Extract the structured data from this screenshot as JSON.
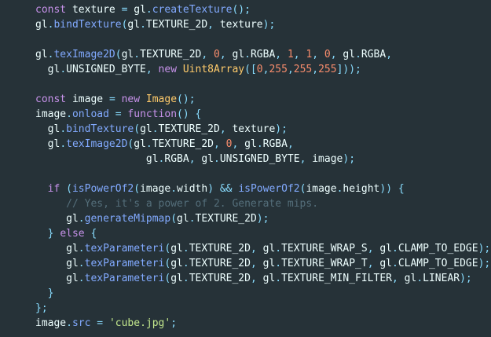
{
  "theme": {
    "background": "#263238",
    "text": "#eeffff",
    "keyword": "#c792ea",
    "function": "#82aaff",
    "number": "#f78c6c",
    "class": "#ffcb6b",
    "string": "#c3e88d",
    "punctuation": "#89ddff",
    "comment": "#546e7a"
  },
  "code_lines": [
    [
      [
        "kw",
        "const"
      ],
      [
        "id",
        " texture "
      ],
      [
        "punc",
        "="
      ],
      [
        "id",
        " gl"
      ],
      [
        "punc",
        "."
      ],
      [
        "fn",
        "createTexture"
      ],
      [
        "punc",
        "();"
      ]
    ],
    [
      [
        "id",
        "gl"
      ],
      [
        "punc",
        "."
      ],
      [
        "fn",
        "bindTexture"
      ],
      [
        "punc",
        "("
      ],
      [
        "id",
        "gl"
      ],
      [
        "punc",
        "."
      ],
      [
        "id",
        "TEXTURE_2D"
      ],
      [
        "punc",
        ","
      ],
      [
        "id",
        " texture"
      ],
      [
        "punc",
        ");"
      ]
    ],
    [],
    [
      [
        "id",
        "gl"
      ],
      [
        "punc",
        "."
      ],
      [
        "fn",
        "texImage2D"
      ],
      [
        "punc",
        "("
      ],
      [
        "id",
        "gl"
      ],
      [
        "punc",
        "."
      ],
      [
        "id",
        "TEXTURE_2D"
      ],
      [
        "punc",
        ","
      ],
      [
        "id",
        " "
      ],
      [
        "num",
        "0"
      ],
      [
        "punc",
        ","
      ],
      [
        "id",
        " gl"
      ],
      [
        "punc",
        "."
      ],
      [
        "id",
        "RGBA"
      ],
      [
        "punc",
        ","
      ],
      [
        "id",
        " "
      ],
      [
        "num",
        "1"
      ],
      [
        "punc",
        ","
      ],
      [
        "id",
        " "
      ],
      [
        "num",
        "1"
      ],
      [
        "punc",
        ","
      ],
      [
        "id",
        " "
      ],
      [
        "num",
        "0"
      ],
      [
        "punc",
        ","
      ],
      [
        "id",
        " gl"
      ],
      [
        "punc",
        "."
      ],
      [
        "id",
        "RGBA"
      ],
      [
        "punc",
        ","
      ]
    ],
    [
      [
        "id",
        "  gl"
      ],
      [
        "punc",
        "."
      ],
      [
        "id",
        "UNSIGNED_BYTE"
      ],
      [
        "punc",
        ","
      ],
      [
        "id",
        " "
      ],
      [
        "kw",
        "new"
      ],
      [
        "id",
        " "
      ],
      [
        "cls",
        "Uint8Array"
      ],
      [
        "punc",
        "(["
      ],
      [
        "num",
        "0"
      ],
      [
        "punc",
        ","
      ],
      [
        "num",
        "255"
      ],
      [
        "punc",
        ","
      ],
      [
        "num",
        "255"
      ],
      [
        "punc",
        ","
      ],
      [
        "num",
        "255"
      ],
      [
        "punc",
        "]));"
      ]
    ],
    [],
    [
      [
        "kw",
        "const"
      ],
      [
        "id",
        " image "
      ],
      [
        "punc",
        "="
      ],
      [
        "id",
        " "
      ],
      [
        "kw",
        "new"
      ],
      [
        "id",
        " "
      ],
      [
        "cls",
        "Image"
      ],
      [
        "punc",
        "();"
      ]
    ],
    [
      [
        "id",
        "image"
      ],
      [
        "punc",
        "."
      ],
      [
        "fn",
        "onload"
      ],
      [
        "id",
        " "
      ],
      [
        "punc",
        "="
      ],
      [
        "id",
        " "
      ],
      [
        "kw",
        "function"
      ],
      [
        "punc",
        "()"
      ],
      [
        "id",
        " "
      ],
      [
        "punc",
        "{"
      ]
    ],
    [
      [
        "id",
        "  gl"
      ],
      [
        "punc",
        "."
      ],
      [
        "fn",
        "bindTexture"
      ],
      [
        "punc",
        "("
      ],
      [
        "id",
        "gl"
      ],
      [
        "punc",
        "."
      ],
      [
        "id",
        "TEXTURE_2D"
      ],
      [
        "punc",
        ","
      ],
      [
        "id",
        " texture"
      ],
      [
        "punc",
        ");"
      ]
    ],
    [
      [
        "id",
        "  gl"
      ],
      [
        "punc",
        "."
      ],
      [
        "fn",
        "texImage2D"
      ],
      [
        "punc",
        "("
      ],
      [
        "id",
        "gl"
      ],
      [
        "punc",
        "."
      ],
      [
        "id",
        "TEXTURE_2D"
      ],
      [
        "punc",
        ","
      ],
      [
        "id",
        " "
      ],
      [
        "num",
        "0"
      ],
      [
        "punc",
        ","
      ],
      [
        "id",
        " gl"
      ],
      [
        "punc",
        "."
      ],
      [
        "id",
        "RGBA"
      ],
      [
        "punc",
        ","
      ]
    ],
    [
      [
        "id",
        "                  gl"
      ],
      [
        "punc",
        "."
      ],
      [
        "id",
        "RGBA"
      ],
      [
        "punc",
        ","
      ],
      [
        "id",
        " gl"
      ],
      [
        "punc",
        "."
      ],
      [
        "id",
        "UNSIGNED_BYTE"
      ],
      [
        "punc",
        ","
      ],
      [
        "id",
        " image"
      ],
      [
        "punc",
        ");"
      ]
    ],
    [],
    [
      [
        "id",
        "  "
      ],
      [
        "kw",
        "if"
      ],
      [
        "id",
        " "
      ],
      [
        "punc",
        "("
      ],
      [
        "fn",
        "isPowerOf2"
      ],
      [
        "punc",
        "("
      ],
      [
        "id",
        "image"
      ],
      [
        "punc",
        "."
      ],
      [
        "id",
        "width"
      ],
      [
        "punc",
        ")"
      ],
      [
        "id",
        " "
      ],
      [
        "punc",
        "&&"
      ],
      [
        "id",
        " "
      ],
      [
        "fn",
        "isPowerOf2"
      ],
      [
        "punc",
        "("
      ],
      [
        "id",
        "image"
      ],
      [
        "punc",
        "."
      ],
      [
        "id",
        "height"
      ],
      [
        "punc",
        "))"
      ],
      [
        "id",
        " "
      ],
      [
        "punc",
        "{"
      ]
    ],
    [
      [
        "cm",
        "     // Yes, it's a power of 2. Generate mips."
      ]
    ],
    [
      [
        "id",
        "     gl"
      ],
      [
        "punc",
        "."
      ],
      [
        "fn",
        "generateMipmap"
      ],
      [
        "punc",
        "("
      ],
      [
        "id",
        "gl"
      ],
      [
        "punc",
        "."
      ],
      [
        "id",
        "TEXTURE_2D"
      ],
      [
        "punc",
        ");"
      ]
    ],
    [
      [
        "id",
        "  "
      ],
      [
        "punc",
        "}"
      ],
      [
        "id",
        " "
      ],
      [
        "kw",
        "else"
      ],
      [
        "id",
        " "
      ],
      [
        "punc",
        "{"
      ]
    ],
    [
      [
        "id",
        "     gl"
      ],
      [
        "punc",
        "."
      ],
      [
        "fn",
        "texParameteri"
      ],
      [
        "punc",
        "("
      ],
      [
        "id",
        "gl"
      ],
      [
        "punc",
        "."
      ],
      [
        "id",
        "TEXTURE_2D"
      ],
      [
        "punc",
        ","
      ],
      [
        "id",
        " gl"
      ],
      [
        "punc",
        "."
      ],
      [
        "id",
        "TEXTURE_WRAP_S"
      ],
      [
        "punc",
        ","
      ],
      [
        "id",
        " gl"
      ],
      [
        "punc",
        "."
      ],
      [
        "id",
        "CLAMP_TO_EDGE"
      ],
      [
        "punc",
        ");"
      ]
    ],
    [
      [
        "id",
        "     gl"
      ],
      [
        "punc",
        "."
      ],
      [
        "fn",
        "texParameteri"
      ],
      [
        "punc",
        "("
      ],
      [
        "id",
        "gl"
      ],
      [
        "punc",
        "."
      ],
      [
        "id",
        "TEXTURE_2D"
      ],
      [
        "punc",
        ","
      ],
      [
        "id",
        " gl"
      ],
      [
        "punc",
        "."
      ],
      [
        "id",
        "TEXTURE_WRAP_T"
      ],
      [
        "punc",
        ","
      ],
      [
        "id",
        " gl"
      ],
      [
        "punc",
        "."
      ],
      [
        "id",
        "CLAMP_TO_EDGE"
      ],
      [
        "punc",
        ");"
      ]
    ],
    [
      [
        "id",
        "     gl"
      ],
      [
        "punc",
        "."
      ],
      [
        "fn",
        "texParameteri"
      ],
      [
        "punc",
        "("
      ],
      [
        "id",
        "gl"
      ],
      [
        "punc",
        "."
      ],
      [
        "id",
        "TEXTURE_2D"
      ],
      [
        "punc",
        ","
      ],
      [
        "id",
        " gl"
      ],
      [
        "punc",
        "."
      ],
      [
        "id",
        "TEXTURE_MIN_FILTER"
      ],
      [
        "punc",
        ","
      ],
      [
        "id",
        " gl"
      ],
      [
        "punc",
        "."
      ],
      [
        "id",
        "LINEAR"
      ],
      [
        "punc",
        ");"
      ]
    ],
    [
      [
        "id",
        "  "
      ],
      [
        "punc",
        "}"
      ]
    ],
    [
      [
        "punc",
        "};"
      ]
    ],
    [
      [
        "id",
        "image"
      ],
      [
        "punc",
        "."
      ],
      [
        "fn",
        "src"
      ],
      [
        "id",
        " "
      ],
      [
        "punc",
        "="
      ],
      [
        "id",
        " "
      ],
      [
        "str",
        "'cube.jpg'"
      ],
      [
        "punc",
        ";"
      ]
    ]
  ]
}
